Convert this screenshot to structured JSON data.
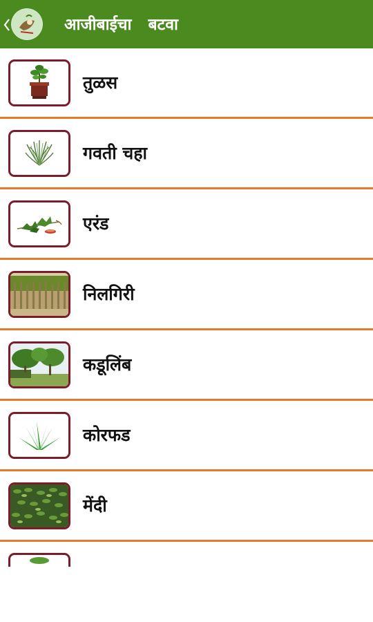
{
  "app": {
    "title": "आजीबाईचा   बटवा",
    "back_icon": "chevron-left-icon",
    "logo_icon": "app-logo-icon"
  },
  "colors": {
    "appbar": "#4a8a1e",
    "divider": "#e8782c",
    "thumb_border": "#7a1c2a",
    "text": "#111111"
  },
  "plants": [
    {
      "name": "तुळस",
      "image": "tulsi-plant-image"
    },
    {
      "name": "गवती चहा",
      "image": "lemongrass-image"
    },
    {
      "name": "एरंड",
      "image": "castor-leaves-image"
    },
    {
      "name": "निलगिरी",
      "image": "eucalyptus-trees-image"
    },
    {
      "name": "कडूलिंब",
      "image": "neem-tree-image"
    },
    {
      "name": "कोरफड",
      "image": "aloe-vera-image"
    },
    {
      "name": "मेंदी",
      "image": "henna-leaves-image"
    },
    {
      "name": "",
      "image": "plant-image"
    }
  ]
}
